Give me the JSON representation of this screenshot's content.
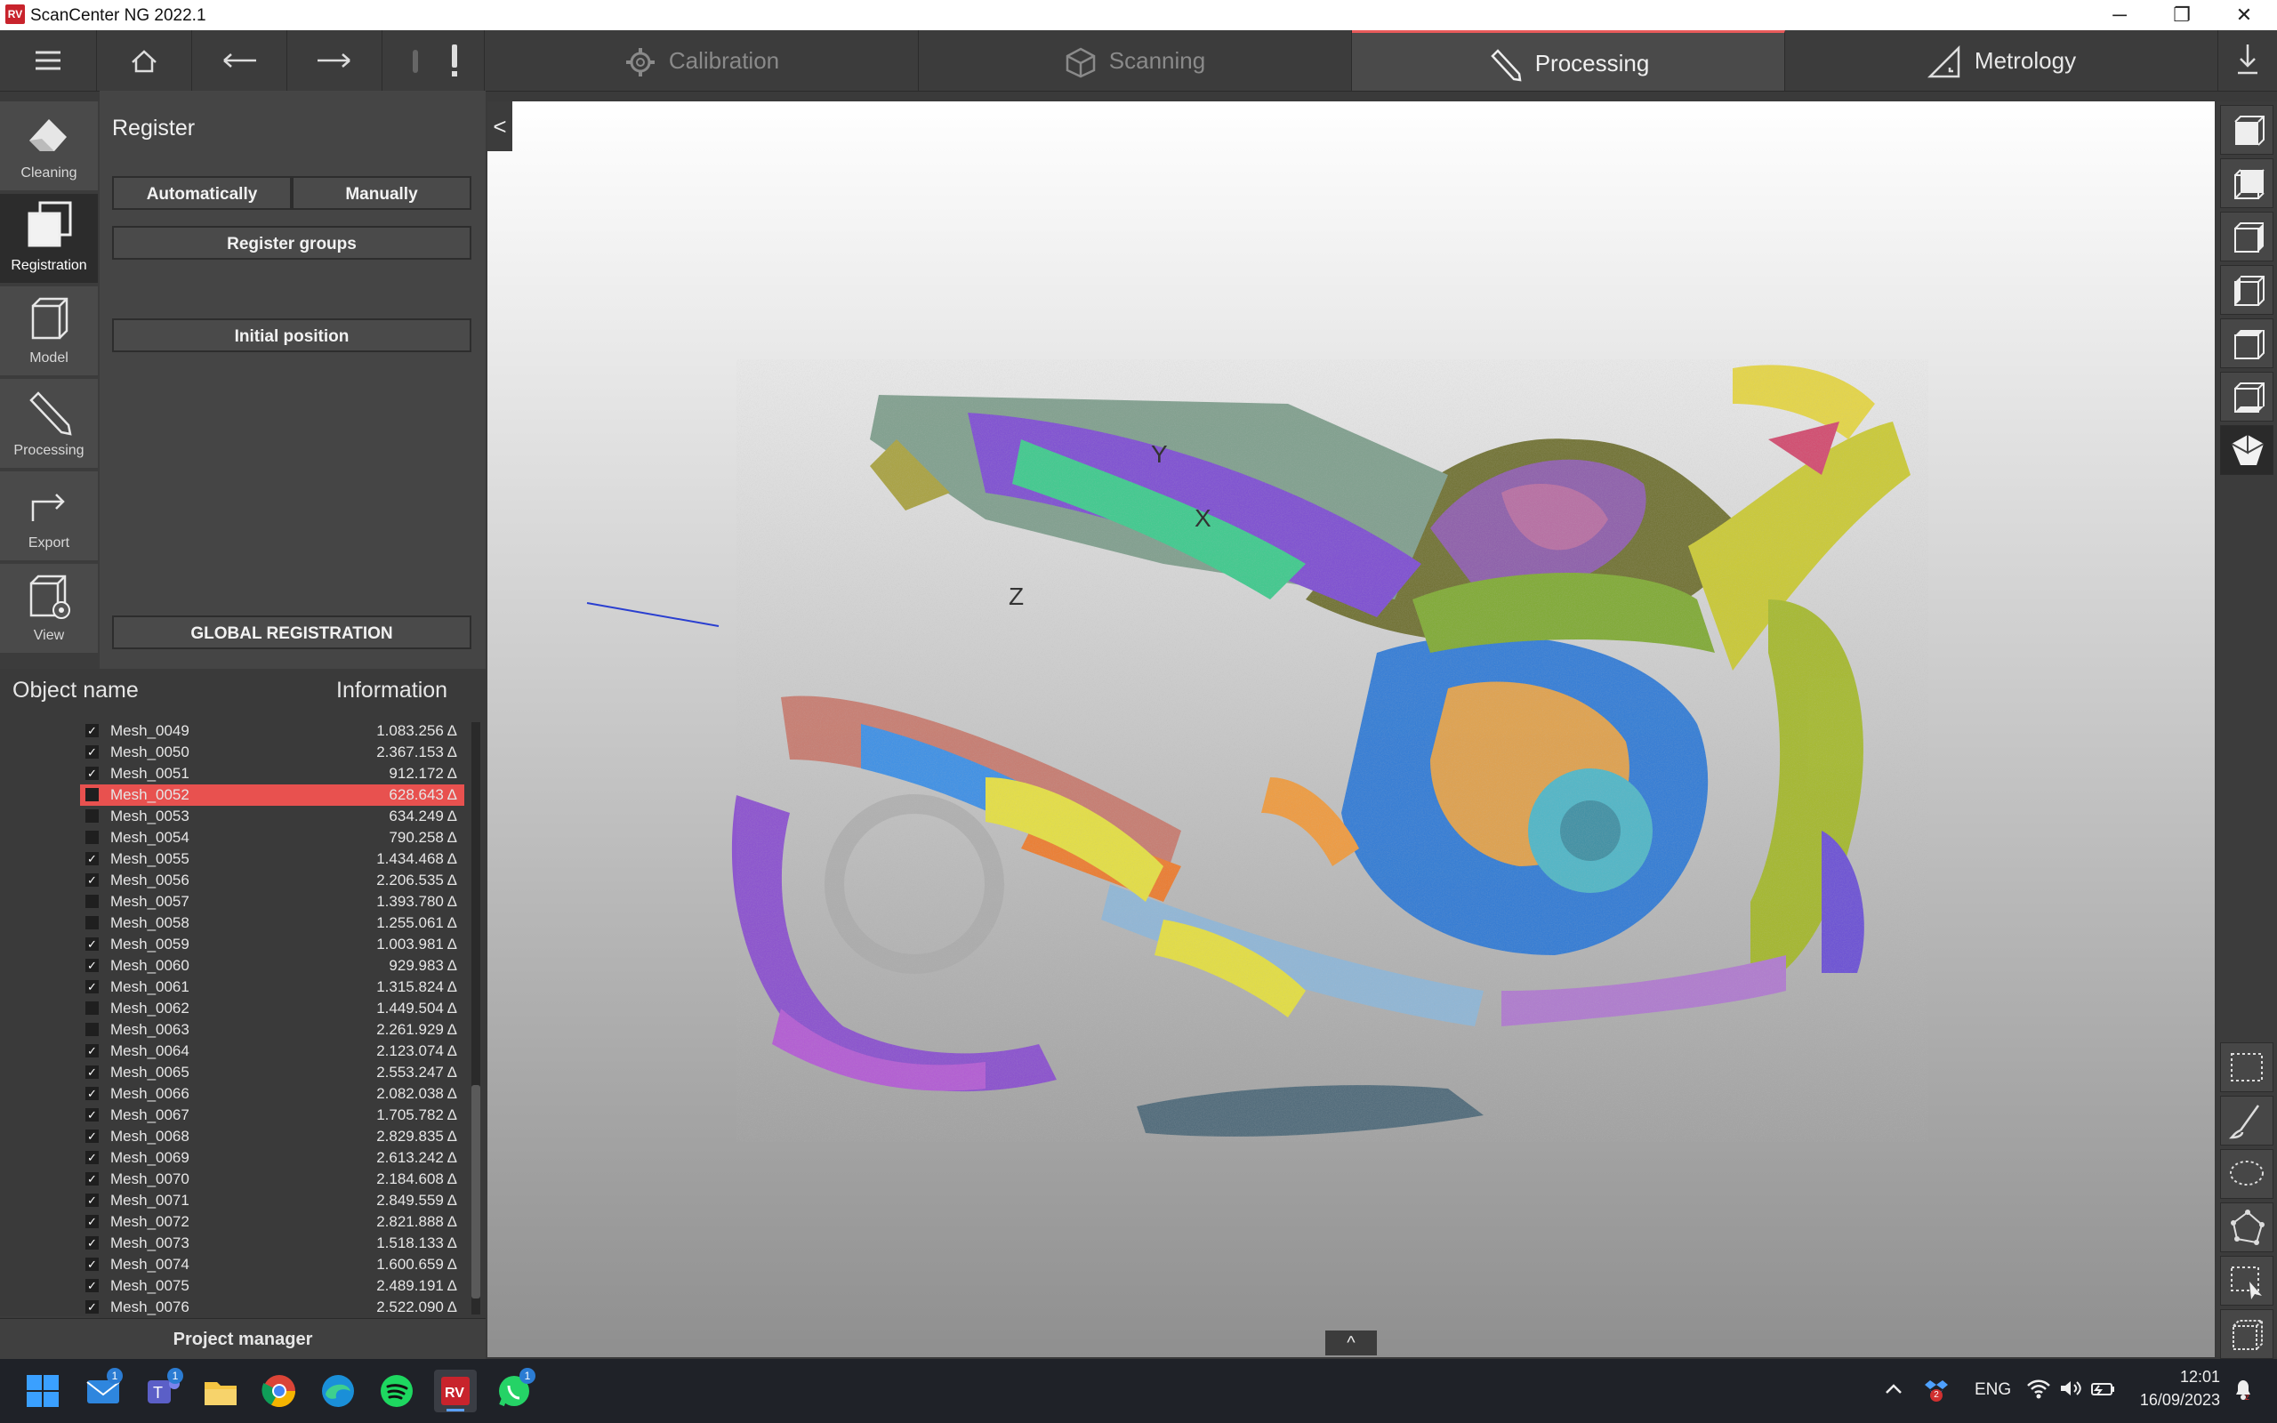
{
  "window": {
    "title": "ScanCenter NG 2022.1",
    "logo_text": "RV",
    "controls": [
      "─",
      "❐",
      "✕"
    ]
  },
  "tabs": [
    {
      "label": "Calibration",
      "icon": "gear-icon",
      "active": false
    },
    {
      "label": "Scanning",
      "icon": "cube-icon",
      "active": false
    },
    {
      "label": "Processing",
      "icon": "pencil-icon",
      "active": true
    },
    {
      "label": "Metrology",
      "icon": "triangle-ruler-icon",
      "active": false
    }
  ],
  "nav": [
    {
      "label": "Cleaning",
      "icon": "eraser-icon",
      "active": false
    },
    {
      "label": "Registration",
      "icon": "registration-icon",
      "active": true
    },
    {
      "label": "Model",
      "icon": "model-icon",
      "active": false
    },
    {
      "label": "Processing",
      "icon": "pencil-icon",
      "active": false
    },
    {
      "label": "Export",
      "icon": "export-icon",
      "active": false
    },
    {
      "label": "View",
      "icon": "view-icon",
      "active": false
    }
  ],
  "panel": {
    "title": "Register",
    "automatically": "Automatically",
    "manually": "Manually",
    "register_groups": "Register groups",
    "initial_position": "Initial position",
    "global_registration": "GLOBAL REGISTRATION"
  },
  "list": {
    "col_name": "Object name",
    "col_info": "Information",
    "rows": [
      {
        "name": "Mesh_0049",
        "info": "1.083.256 Δ",
        "checked": true
      },
      {
        "name": "Mesh_0050",
        "info": "2.367.153 Δ",
        "checked": true
      },
      {
        "name": "Mesh_0051",
        "info": "912.172 Δ",
        "checked": true
      },
      {
        "name": "Mesh_0052",
        "info": "628.643 Δ",
        "checked": false,
        "selected": true
      },
      {
        "name": "Mesh_0053",
        "info": "634.249 Δ",
        "checked": false
      },
      {
        "name": "Mesh_0054",
        "info": "790.258 Δ",
        "checked": false
      },
      {
        "name": "Mesh_0055",
        "info": "1.434.468 Δ",
        "checked": true
      },
      {
        "name": "Mesh_0056",
        "info": "2.206.535 Δ",
        "checked": true
      },
      {
        "name": "Mesh_0057",
        "info": "1.393.780 Δ",
        "checked": false
      },
      {
        "name": "Mesh_0058",
        "info": "1.255.061 Δ",
        "checked": false
      },
      {
        "name": "Mesh_0059",
        "info": "1.003.981 Δ",
        "checked": true
      },
      {
        "name": "Mesh_0060",
        "info": "929.983 Δ",
        "checked": true
      },
      {
        "name": "Mesh_0061",
        "info": "1.315.824 Δ",
        "checked": true
      },
      {
        "name": "Mesh_0062",
        "info": "1.449.504 Δ",
        "checked": false
      },
      {
        "name": "Mesh_0063",
        "info": "2.261.929 Δ",
        "checked": false
      },
      {
        "name": "Mesh_0064",
        "info": "2.123.074 Δ",
        "checked": true
      },
      {
        "name": "Mesh_0065",
        "info": "2.553.247 Δ",
        "checked": true
      },
      {
        "name": "Mesh_0066",
        "info": "2.082.038 Δ",
        "checked": true
      },
      {
        "name": "Mesh_0067",
        "info": "1.705.782 Δ",
        "checked": true
      },
      {
        "name": "Mesh_0068",
        "info": "2.829.835 Δ",
        "checked": true
      },
      {
        "name": "Mesh_0069",
        "info": "2.613.242 Δ",
        "checked": true
      },
      {
        "name": "Mesh_0070",
        "info": "2.184.608 Δ",
        "checked": true
      },
      {
        "name": "Mesh_0071",
        "info": "2.849.559 Δ",
        "checked": true
      },
      {
        "name": "Mesh_0072",
        "info": "2.821.888 Δ",
        "checked": true
      },
      {
        "name": "Mesh_0073",
        "info": "1.518.133 Δ",
        "checked": true
      },
      {
        "name": "Mesh_0074",
        "info": "1.600.659 Δ",
        "checked": true
      },
      {
        "name": "Mesh_0075",
        "info": "2.489.191 Δ",
        "checked": true
      },
      {
        "name": "Mesh_0076",
        "info": "2.522.090 Δ",
        "checked": true
      }
    ]
  },
  "project_manager": "Project manager",
  "viewport": {
    "axis_x": "X",
    "axis_y": "Y",
    "axis_z": "Z",
    "collapse": "<",
    "expand": "^"
  },
  "right_icons": [
    "front-view-icon",
    "back-view-icon",
    "right-view-icon",
    "left-view-icon",
    "top-view-icon",
    "bottom-view-icon",
    "iso-view-icon",
    "rect-select-icon",
    "brush-select-icon",
    "lasso-select-icon",
    "polygon-select-icon",
    "select-cursor-icon",
    "box-select-icon"
  ],
  "taskbar": {
    "lang": "ENG",
    "time": "12:01",
    "date": "16/09/2023",
    "mail_badge": "1",
    "teams_badge": "1",
    "whatsapp_badge": "1",
    "dropbox_badge": "2"
  }
}
